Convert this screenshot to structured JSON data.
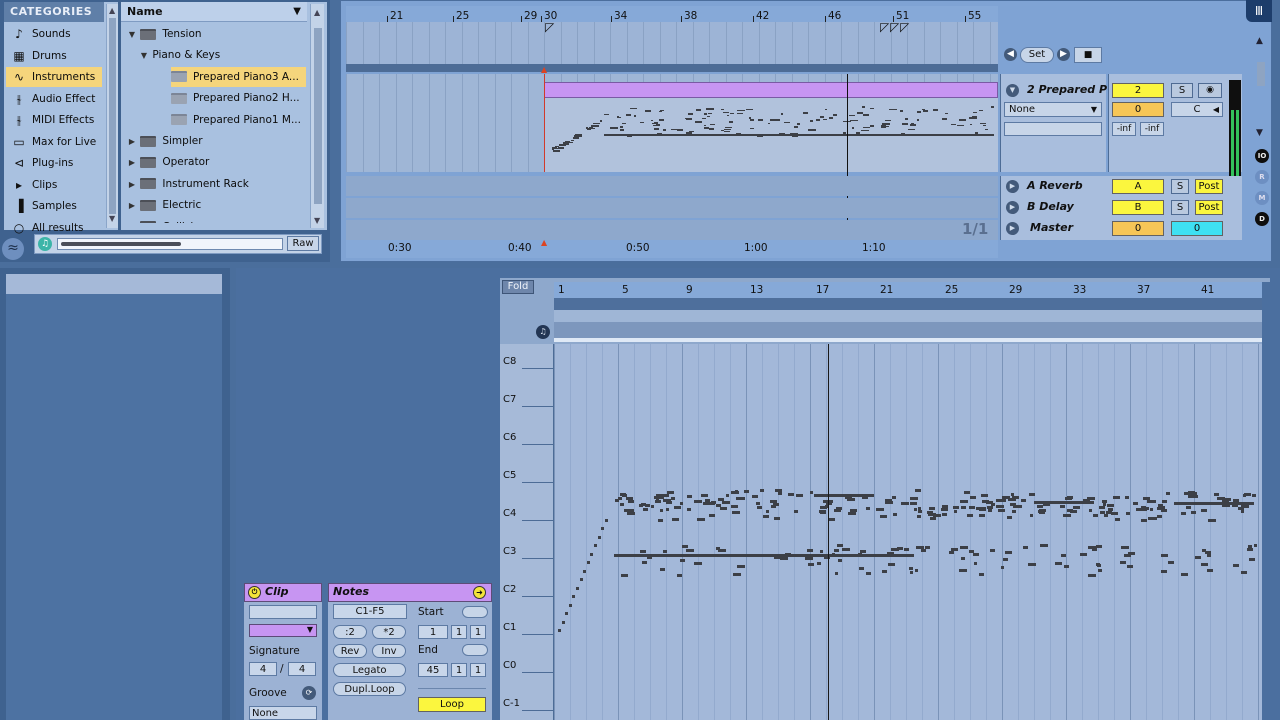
{
  "browser": {
    "categories_title": "CATEGORIES",
    "categories": [
      {
        "label": "Sounds",
        "icon": "note-icon",
        "glyph": "♪"
      },
      {
        "label": "Drums",
        "icon": "grid-icon",
        "glyph": "▦"
      },
      {
        "label": "Instruments",
        "icon": "wave-icon",
        "glyph": "∿",
        "selected": true
      },
      {
        "label": "Audio Effect",
        "icon": "audio-effect-icon",
        "glyph": "⫳"
      },
      {
        "label": "MIDI Effects",
        "icon": "midi-effect-icon",
        "glyph": "⫳"
      },
      {
        "label": "Max for Live",
        "icon": "max-icon",
        "glyph": "▭"
      },
      {
        "label": "Plug-ins",
        "icon": "plug-icon",
        "glyph": "⊲"
      },
      {
        "label": "Clips",
        "icon": "clip-icon",
        "glyph": "▸"
      },
      {
        "label": "Samples",
        "icon": "sample-icon",
        "glyph": "▐"
      },
      {
        "label": "All results",
        "icon": "search-icon",
        "glyph": "○"
      }
    ],
    "name_header": "Name",
    "files": [
      {
        "label": "Tension",
        "indent": 0,
        "arrow": "▼"
      },
      {
        "label": "Piano & Keys",
        "indent": 1,
        "arrow": "▼"
      },
      {
        "label": "Prepared Piano3 A...",
        "indent": 2,
        "arrow": "",
        "selected": true
      },
      {
        "label": "Prepared Piano2 H...",
        "indent": 2,
        "arrow": ""
      },
      {
        "label": "Prepared Piano1 M...",
        "indent": 2,
        "arrow": ""
      },
      {
        "label": "Simpler",
        "indent": 0,
        "arrow": "▶"
      },
      {
        "label": "Operator",
        "indent": 0,
        "arrow": "▶"
      },
      {
        "label": "Instrument Rack",
        "indent": 0,
        "arrow": "▶"
      },
      {
        "label": "Electric",
        "indent": 0,
        "arrow": "▶"
      },
      {
        "label": "Collision",
        "indent": 0,
        "arrow": "▶"
      }
    ],
    "raw_label": "Raw"
  },
  "arrangement": {
    "bar_numbers": [
      "21",
      "25",
      "29",
      "30",
      "34",
      "38",
      "42",
      "46",
      "51",
      "55"
    ],
    "time_labels": [
      "0:30",
      "0:40",
      "0:50",
      "1:00",
      "1:10"
    ],
    "set_label": "Set",
    "page_indicator": "1/1",
    "tracks": [
      {
        "name": "2 Prepared P",
        "num": "2",
        "vol": "0",
        "pan": "C",
        "io": "None",
        "inf1": "-inf",
        "inf2": "-inf",
        "solo": "S"
      },
      {
        "name": "A Reverb",
        "send": "A",
        "solo": "S",
        "post": "Post"
      },
      {
        "name": "B Delay",
        "send": "B",
        "solo": "S",
        "post": "Post"
      },
      {
        "name": "Master",
        "vol": "0",
        "pan": "0"
      }
    ],
    "side_buttons": [
      "IO",
      "R",
      "M",
      "D"
    ]
  },
  "piano_roll": {
    "fold_label": "Fold",
    "bar_numbers": [
      "1",
      "5",
      "9",
      "13",
      "17",
      "21",
      "25",
      "29",
      "33",
      "37",
      "41"
    ],
    "keys": [
      "C8",
      "C7",
      "C6",
      "C5",
      "C4",
      "C3",
      "C2",
      "C1",
      "C0",
      "C-1"
    ]
  },
  "clip_view": {
    "clip_title": "Clip",
    "notes_title": "Notes",
    "range": "C1-F5",
    "btn_div2": ":2",
    "btn_mul2": "*2",
    "btn_rev": "Rev",
    "btn_inv": "Inv",
    "btn_legato": "Legato",
    "btn_dupl": "Dupl.Loop",
    "signature_label": "Signature",
    "sig_num": "4",
    "sig_slash": "/",
    "sig_den": "4",
    "groove_label": "Groove",
    "groove_value": "None",
    "start_label": "Start",
    "start_vals": [
      "1",
      "1",
      "1"
    ],
    "end_label": "End",
    "end_vals": [
      "45",
      "1",
      "1"
    ],
    "loop_label": "Loop"
  },
  "colors": {
    "clip": "#c795f2",
    "accent_yellow": "#fbf63e",
    "selection": "#f5d57c"
  }
}
